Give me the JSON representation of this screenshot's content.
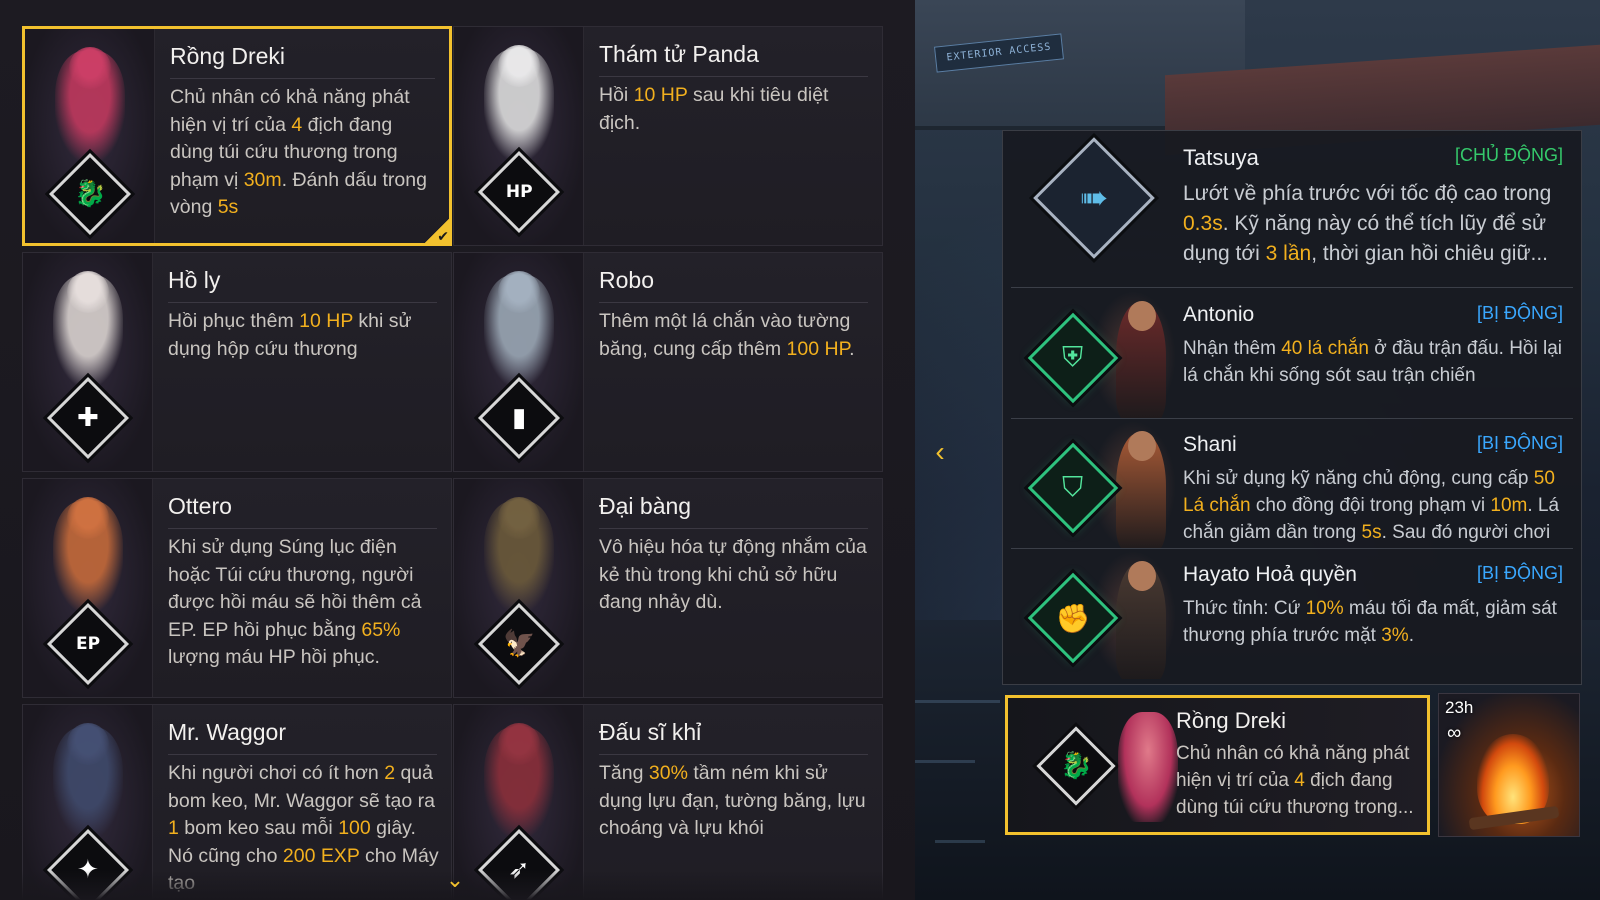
{
  "pets": [
    {
      "name": "Rồng Dreki",
      "icon": "dragon-eye-icon",
      "icon_glyph": "🐉",
      "body_color": "#c0395e",
      "selected": true,
      "desc": [
        {
          "t": "Chủ nhân có khả năng phát hiện vị trí của "
        },
        {
          "t": "4",
          "h": true
        },
        {
          "t": " địch đang dùng túi cứu thương trong phạm vị "
        },
        {
          "t": "30m",
          "h": true
        },
        {
          "t": ". Đánh dấu trong vòng "
        },
        {
          "t": "5s",
          "h": true
        }
      ]
    },
    {
      "name": "Thám tử Panda",
      "icon": "hp-paw-icon",
      "icon_glyph": "HP",
      "body_color": "#dcdcdc",
      "selected": false,
      "desc": [
        {
          "t": "Hồi "
        },
        {
          "t": "10 HP",
          "h": true
        },
        {
          "t": " sau khi  tiêu diệt địch."
        }
      ]
    },
    {
      "name": "Hồ ly",
      "icon": "medkit-icon",
      "icon_glyph": "✚",
      "body_color": "#d9d2cf",
      "selected": false,
      "desc": [
        {
          "t": "Hồi phục thêm "
        },
        {
          "t": "10 HP",
          "h": true
        },
        {
          "t": " khi sử dụng hộp cứu thương"
        }
      ]
    },
    {
      "name": "Robo",
      "icon": "gloo-wall-icon",
      "icon_glyph": "▮",
      "body_color": "#9aa7b4",
      "selected": false,
      "desc": [
        {
          "t": "Thêm một lá chắn vào tường băng, cung cấp thêm "
        },
        {
          "t": "100 HP",
          "h": true
        },
        {
          "t": "."
        }
      ]
    },
    {
      "name": "Ottero",
      "icon": "ep-plus-icon",
      "icon_glyph": "EP",
      "body_color": "#c46a3a",
      "selected": false,
      "desc": [
        {
          "t": "Khi sử dụng Súng lục điện hoặc Túi cứu thương, người được hồi máu sẽ hồi thêm cả EP. EP hồi phục bằng "
        },
        {
          "t": "65%",
          "h": true
        },
        {
          "t": " lượng máu HP hồi phục."
        }
      ]
    },
    {
      "name": "Đại bàng",
      "icon": "eagle-icon",
      "icon_glyph": "🦅",
      "body_color": "#6b5a3a",
      "selected": false,
      "desc": [
        {
          "t": "Vô hiệu hóa tự động nhắm của kẻ thù trong khi chủ sở hữu đang nhảy dù."
        }
      ]
    },
    {
      "name": "Mr. Waggor",
      "icon": "grenade-icon",
      "icon_glyph": "✦",
      "body_color": "#3f4a6b",
      "selected": false,
      "desc": [
        {
          "t": "Khi người chơi có ít hơn "
        },
        {
          "t": "2",
          "h": true
        },
        {
          "t": " quả bom keo, Mr. Waggor sẽ tạo ra "
        },
        {
          "t": "1",
          "h": true
        },
        {
          "t": " bom keo sau mỗi "
        },
        {
          "t": "100",
          "h": true
        },
        {
          "t": " giây. Nó cũng cho "
        },
        {
          "t": "200 EXP",
          "h": true
        },
        {
          "t": " cho Máy tạo"
        }
      ]
    },
    {
      "name": "Đấu sĩ khỉ",
      "icon": "throwable-icon",
      "icon_glyph": "➶",
      "body_color": "#8a2f3a",
      "selected": false,
      "desc": [
        {
          "t": "Tăng "
        },
        {
          "t": "30%",
          "h": true
        },
        {
          "t": " tầm ném khi sử dụng lựu đạn, tường băng, lựu choáng và lựu khói"
        }
      ]
    }
  ],
  "skills": [
    {
      "name": "Tatsuya",
      "type": "[CHỦ ĐỘNG]",
      "active": true,
      "icon": "dash-icon",
      "icon_glyph": "➠",
      "desc": [
        {
          "t": "Lướt về phía trước với tốc độ cao trong "
        },
        {
          "t": "0.3s",
          "h": true
        },
        {
          "t": ". Kỹ năng này có thể tích lũy để sử dụng tới "
        },
        {
          "t": "3 lần",
          "h": true
        },
        {
          "t": ", thời gian hồi chiêu giữ..."
        }
      ]
    },
    {
      "name": "Antonio",
      "type": "[BỊ ĐỘNG]",
      "active": false,
      "icon": "shield-up-icon",
      "icon_glyph": "⛨",
      "char_color": "#6b2a2a",
      "desc": [
        {
          "t": "Nhận thêm "
        },
        {
          "t": "40 lá chắn",
          "h": true
        },
        {
          "t": " ở đầu trận đấu. Hồi lại lá chắn khi sống sót sau trận chiến"
        }
      ]
    },
    {
      "name": "Shani",
      "type": "[BỊ ĐỘNG]",
      "active": false,
      "icon": "shield-team-icon",
      "icon_glyph": "⛉",
      "char_color": "#a85a36",
      "desc": [
        {
          "t": "Khi sử dụng kỹ năng chủ động, cung cấp "
        },
        {
          "t": "50 Lá chắn",
          "h": true
        },
        {
          "t": " cho đồng đội trong phạm vi "
        },
        {
          "t": "10m",
          "h": true
        },
        {
          "t": ". Lá chắn giảm dần trong "
        },
        {
          "t": "5s",
          "h": true
        },
        {
          "t": ". Sau đó người chơi có thể..."
        }
      ]
    },
    {
      "name": "Hayato Hoả quyền",
      "type": "[BỊ ĐỘNG]",
      "active": false,
      "icon": "armor-fist-icon",
      "icon_glyph": "✊",
      "char_color": "#4a3a32",
      "desc": [
        {
          "t": "Thức tỉnh: Cứ "
        },
        {
          "t": "10%",
          "h": true
        },
        {
          "t": " máu tối đa mất, giảm sát thương phía trước mặt "
        },
        {
          "t": "3%",
          "h": true
        },
        {
          "t": "."
        }
      ]
    }
  ],
  "selected_pet": {
    "name": "Rồng Dreki",
    "icon": "dragon-eye-icon",
    "icon_glyph": "🐉",
    "desc": [
      {
        "t": "Chủ nhân có khả năng phát hiện vị trí của "
      },
      {
        "t": "4",
        "h": true
      },
      {
        "t": " địch đang dùng túi cứu thương trong..."
      }
    ]
  },
  "campfire": {
    "timer": "23h",
    "infinity": "∞",
    "icon": "campfire-icon"
  },
  "scene": {
    "sign_text": "EXTERIOR ACCESS"
  },
  "controls": {
    "scroll_down": "⌄",
    "collapse": "‹",
    "check": "✔"
  },
  "colors": {
    "accent": "#f2c12e",
    "highlight": "#f2b01e",
    "passive": "#3aa8ff",
    "active": "#35c96b"
  }
}
